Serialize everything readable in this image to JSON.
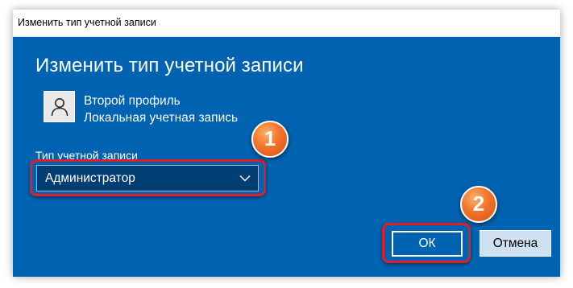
{
  "window": {
    "title": "Изменить тип учетной записи"
  },
  "dialog": {
    "heading": "Изменить тип учетной записи",
    "user": {
      "name": "Второй профиль",
      "account_kind": "Локальная учетная запись",
      "avatar_icon": "user-silhouette-icon"
    },
    "account_type": {
      "label": "Тип учетной записи",
      "selected": "Администратор",
      "chevron_icon": "chevron-down-icon"
    },
    "buttons": {
      "ok_label": "ОК",
      "cancel_label": "Отмена"
    }
  },
  "annotations": {
    "step1_label": "1",
    "step2_label": "2",
    "highlight_color": "#e01e26",
    "badge_color": "#f3722a"
  },
  "colors": {
    "dialog_background": "#0063b1",
    "select_background": "#003e73",
    "cancel_background": "#cfe0f1"
  }
}
